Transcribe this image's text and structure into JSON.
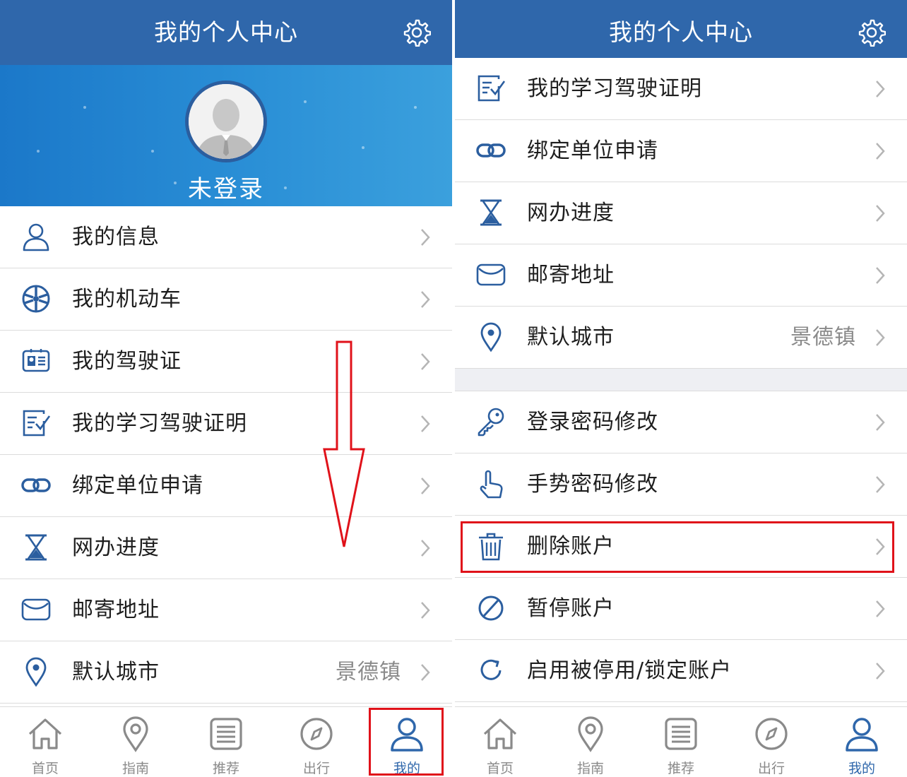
{
  "header": {
    "title": "我的个人中心",
    "settings_icon": "gear-icon"
  },
  "profile": {
    "login_status": "未登录",
    "avatar_icon": "avatar-placeholder"
  },
  "menu": {
    "my_info": {
      "label": "我的信息",
      "icon": "user-icon"
    },
    "my_vehicle": {
      "label": "我的机动车",
      "icon": "wheel-icon"
    },
    "my_license": {
      "label": "我的驾驶证",
      "icon": "id-card-icon"
    },
    "my_study_cert": {
      "label": "我的学习驾驶证明",
      "icon": "checklist-icon"
    },
    "bind_unit": {
      "label": "绑定单位申请",
      "icon": "link-icon"
    },
    "online_progress": {
      "label": "网办进度",
      "icon": "hourglass-icon"
    },
    "mail_address": {
      "label": "邮寄地址",
      "icon": "mail-icon"
    },
    "default_city": {
      "label": "默认城市",
      "value": "景德镇",
      "icon": "location-pin-icon"
    },
    "login_password": {
      "label": "登录密码修改",
      "icon": "key-icon"
    },
    "gesture_password": {
      "label": "手势密码修改",
      "icon": "hand-pointer-icon"
    },
    "delete_account": {
      "label": "删除账户",
      "icon": "trash-icon"
    },
    "suspend_account": {
      "label": "暂停账户",
      "icon": "ban-icon"
    },
    "enable_account": {
      "label": "启用被停用/锁定账户",
      "icon": "refresh-icon"
    }
  },
  "tabbar": {
    "home": {
      "label": "首页",
      "icon": "home-icon"
    },
    "guide": {
      "label": "指南",
      "icon": "map-pin-icon"
    },
    "recommend": {
      "label": "推荐",
      "icon": "list-icon"
    },
    "travel": {
      "label": "出行",
      "icon": "compass-icon"
    },
    "mine": {
      "label": "我的",
      "icon": "person-icon"
    }
  },
  "colors": {
    "header": "#2f67ab",
    "icon_blue": "#2b5e9f",
    "active_tab": "#2f67ab",
    "inactive_tab": "#8a8a8a",
    "highlight": "#e0121a"
  }
}
